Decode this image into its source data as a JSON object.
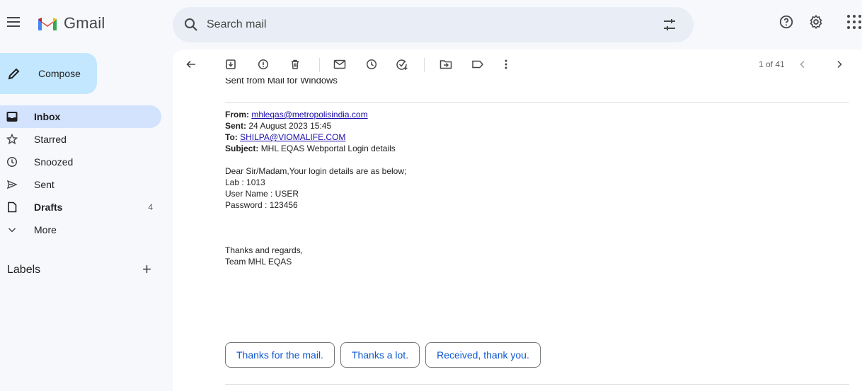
{
  "app": {
    "name": "Gmail",
    "accent": "#c2e7ff",
    "active_bg": "#d3e3fd",
    "link_color": "#1a0dab"
  },
  "search": {
    "placeholder": "Search mail",
    "icon": "search-icon",
    "filter_icon": "tune-icon"
  },
  "top_icons": [
    "help-icon",
    "settings-icon",
    "apps-icon"
  ],
  "compose": {
    "label": "Compose"
  },
  "nav": [
    {
      "label": "Inbox",
      "icon": "inbox-icon",
      "active": true,
      "bold": true,
      "count": ""
    },
    {
      "label": "Starred",
      "icon": "star-icon",
      "active": false,
      "bold": false,
      "count": ""
    },
    {
      "label": "Snoozed",
      "icon": "clock-icon",
      "active": false,
      "bold": false,
      "count": ""
    },
    {
      "label": "Sent",
      "icon": "send-icon",
      "active": false,
      "bold": false,
      "count": ""
    },
    {
      "label": "Drafts",
      "icon": "draft-icon",
      "active": false,
      "bold": true,
      "count": "4"
    },
    {
      "label": "More",
      "icon": "chevron-down-icon",
      "active": false,
      "bold": false,
      "count": ""
    }
  ],
  "labels": {
    "heading": "Labels"
  },
  "toolbar": {
    "icons": [
      "back-arrow-icon",
      "archive-icon",
      "report-spam-icon",
      "delete-icon",
      "mark-unread-icon",
      "snooze-icon",
      "add-task-icon",
      "move-to-icon",
      "label-icon",
      "more-vert-icon"
    ],
    "pager": "1 of 41"
  },
  "email": {
    "cut_line": "Sent from Mail for Windows",
    "from_label": "From:",
    "from_value": "mhleqas@metropolisindia.com",
    "sent_label": "Sent:",
    "sent_value": "24 August 2023 15:45",
    "to_label": "To:",
    "to_value": "SHILPA@VIOMALIFE.COM",
    "subject_label": "Subject:",
    "subject_value": "MHL EQAS Webportal Login details",
    "lines": [
      "Dear Sir/Madam,Your login details are as below;",
      "Lab : 1013",
      "User Name : USER",
      "Password : 123456"
    ],
    "closing": [
      "Thanks and regards,",
      "Team MHL EQAS"
    ]
  },
  "smart_replies": [
    "Thanks for the mail.",
    "Thanks a lot.",
    "Received, thank you."
  ]
}
